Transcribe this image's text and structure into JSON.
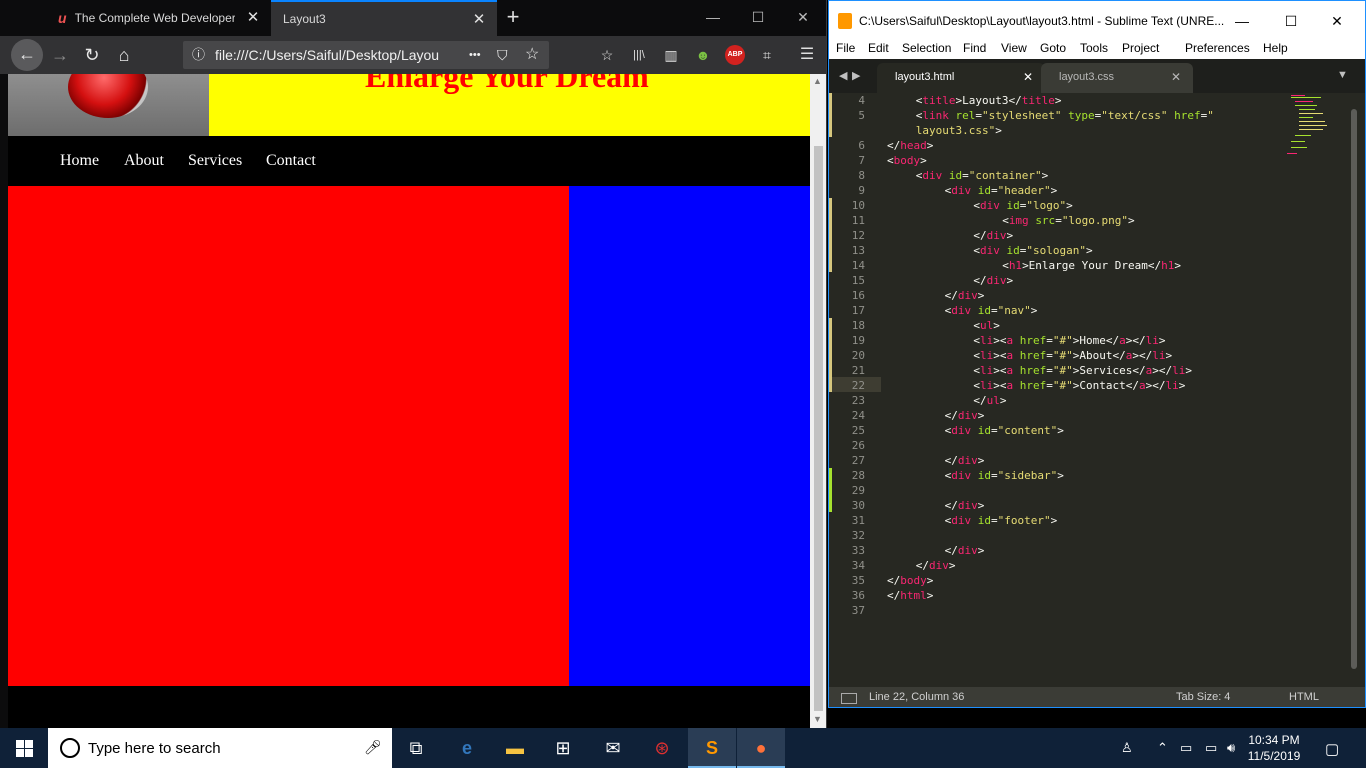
{
  "browser": {
    "tabs": [
      {
        "label": "The Complete Web Developer",
        "close": "✕"
      },
      {
        "label": "Layout3",
        "close": "✕"
      }
    ],
    "new_tab": "+",
    "window_controls": {
      "minimize": "—",
      "maximize": "☐",
      "close": "✕"
    },
    "nav": {
      "back": "←",
      "forward": "→",
      "reload": "↻",
      "home": "⌂"
    },
    "url": "file:///C:/Users/Saiful/Desktop/Layou",
    "url_info_icon": "ⓘ",
    "url_actions": {
      "more": "•••",
      "pocket": "⛉",
      "bookmark": "☆"
    },
    "toolbar": {
      "star": "☆",
      "library": "|||\\",
      "sidebar": "▥",
      "ext": "☻",
      "abp": "ABP",
      "crop": "⌗",
      "menu": "☰"
    }
  },
  "webpage": {
    "slogan": "Enlarge Your Dream",
    "nav": [
      "Home",
      "About",
      "Services",
      "Contact"
    ],
    "colors": {
      "logo_bg": "#7f7f7f",
      "slogan_bg": "#ffff00",
      "slogan_text": "#ff0000",
      "nav_bg": "#000000",
      "content": "#ff0000",
      "sidebar": "#0000ff",
      "footer": "#000000"
    }
  },
  "editor": {
    "title": "C:\\Users\\Saiful\\Desktop\\Layout\\layout3.html - Sublime Text (UNRE...",
    "window_controls": {
      "minimize": "—",
      "maximize": "☐",
      "close": "✕"
    },
    "menu": [
      "File",
      "Edit",
      "Selection",
      "Find",
      "View",
      "Goto",
      "Tools",
      "Project",
      "Preferences",
      "Help"
    ],
    "tab_arrows": {
      "left": "◀",
      "right": "▶",
      "dropdown": "▼"
    },
    "tabs": [
      {
        "label": "layout3.html",
        "close": "✕"
      },
      {
        "label": "layout3.css",
        "close": "✕"
      }
    ],
    "line_numbers": [
      "4",
      "5",
      "",
      "6",
      "7",
      "8",
      "9",
      "10",
      "11",
      "12",
      "13",
      "14",
      "15",
      "16",
      "17",
      "18",
      "19",
      "20",
      "21",
      "22",
      "23",
      "24",
      "25",
      "26",
      "27",
      "28",
      "29",
      "30",
      "31",
      "32",
      "33",
      "34",
      "35",
      "36",
      "37"
    ],
    "status": {
      "position": "Line 22, Column 36",
      "tab_size": "Tab Size: 4",
      "syntax": "HTML"
    }
  },
  "taskbar": {
    "search_placeholder": "Type here to search",
    "apps": [
      "task-view",
      "edge",
      "file-explorer",
      "store",
      "mail",
      "app",
      "sublime-text",
      "firefox"
    ],
    "clock": {
      "time": "10:34 PM",
      "date": "11/5/2019"
    }
  }
}
